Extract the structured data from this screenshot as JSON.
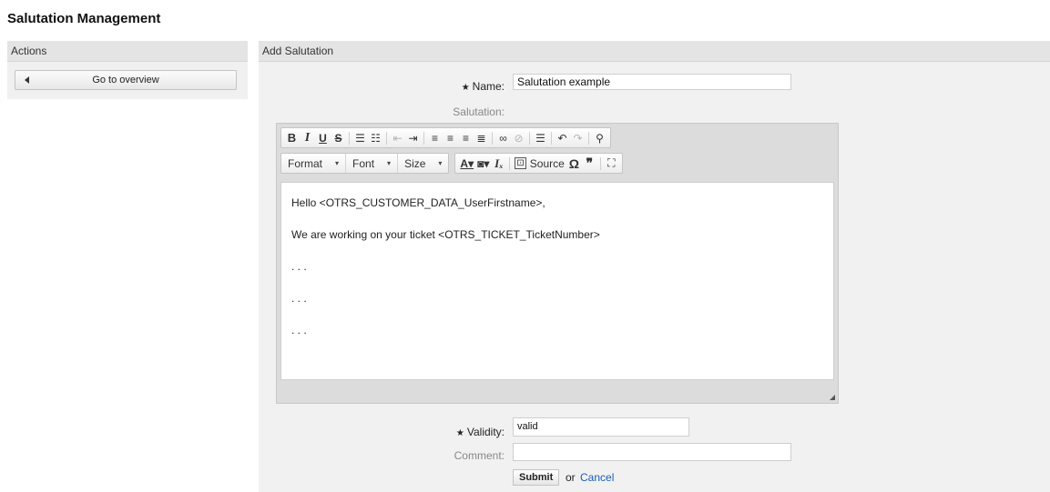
{
  "page": {
    "title": "Salutation Management"
  },
  "sidebar": {
    "header": "Actions",
    "overview_button": {
      "label": "Go to overview",
      "icon": "arrow-left-icon"
    }
  },
  "main": {
    "header": "Add Salutation",
    "form": {
      "name": {
        "label": "Name:",
        "value": "Salutation example",
        "required": true
      },
      "salutation": {
        "label": "Salutation:"
      },
      "validity": {
        "label": "Validity:",
        "value": "valid",
        "required": true
      },
      "comment": {
        "label": "Comment:",
        "value": ""
      },
      "submit_label": "Submit",
      "or_text": "or",
      "cancel_label": "Cancel"
    },
    "editor": {
      "toolbar_row1": [
        {
          "glyph": "B",
          "icon": "bold-icon"
        },
        {
          "glyph": "I",
          "icon": "italic-icon"
        },
        {
          "glyph": "U",
          "icon": "underline-icon"
        },
        {
          "glyph": "S",
          "icon": "strikethrough-icon"
        },
        {
          "glyph": "☰",
          "icon": "numbered-list-icon"
        },
        {
          "glyph": "☷",
          "icon": "bulleted-list-icon"
        },
        {
          "glyph": "⇤",
          "icon": "outdent-icon"
        },
        {
          "glyph": "⇥",
          "icon": "indent-icon"
        },
        {
          "glyph": "≡",
          "icon": "align-left-icon"
        },
        {
          "glyph": "≡",
          "icon": "align-center-icon"
        },
        {
          "glyph": "≡",
          "icon": "align-right-icon"
        },
        {
          "glyph": "≣",
          "icon": "justify-icon"
        },
        {
          "glyph": "∞",
          "icon": "link-icon"
        },
        {
          "glyph": "⊘",
          "icon": "unlink-icon"
        },
        {
          "glyph": "☰",
          "icon": "horizontal-rule-icon"
        },
        {
          "glyph": "↶",
          "icon": "undo-icon"
        },
        {
          "glyph": "↷",
          "icon": "redo-icon"
        },
        {
          "glyph": "⚲",
          "icon": "find-icon"
        }
      ],
      "format_label": "Format",
      "font_label": "Font",
      "size_label": "Size",
      "source_label": "Source",
      "content": [
        "Hello <OTRS_CUSTOMER_DATA_UserFirstname>,",
        "We are working on your ticket <OTRS_TICKET_TicketNumber>",
        ". . .",
        ". . .",
        ". . ."
      ]
    }
  }
}
